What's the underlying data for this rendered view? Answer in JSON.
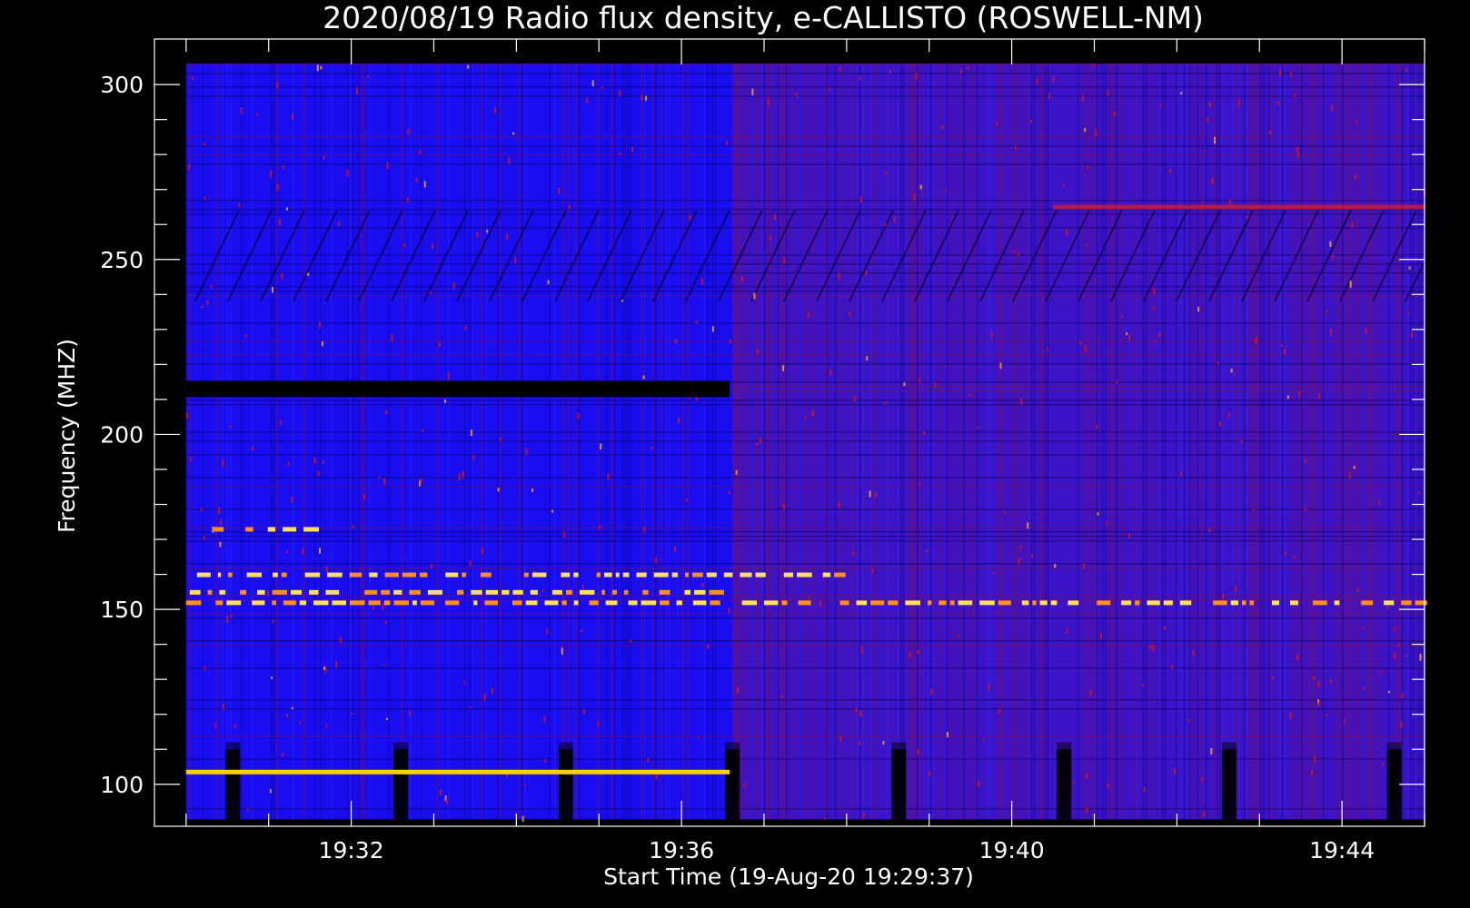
{
  "chart_data": {
    "type": "heatmap",
    "title": "2020/08/19  Radio flux density, e-CALLISTO (ROSWELL-NM)",
    "xlabel": "Start Time (19-Aug-20 19:29:37)",
    "ylabel": "Frequency (MHZ)",
    "x_ticks": [
      "19:32",
      "19:36",
      "19:40",
      "19:44"
    ],
    "y_ticks": [
      "100",
      "150",
      "200",
      "250",
      "300"
    ],
    "x_range": [
      "19:29:37",
      "19:45:00"
    ],
    "ylim": [
      313,
      88
    ],
    "data_extent": {
      "time_start": "19:30:00",
      "time_end": "19:45:00",
      "freq_min": 90,
      "freq_max": 306
    },
    "colors": {
      "background": "#000000",
      "low_flux": "#1a0df0",
      "mid_flux": "#b01020",
      "high_flux": "#ffe000",
      "gap": "#000000"
    },
    "vertical_gaps": [
      "19:30:34",
      "19:32:36",
      "19:34:36",
      "19:36:37",
      "19:38:38",
      "19:40:38",
      "19:42:38",
      "19:44:38"
    ],
    "horizontal_features": [
      {
        "freq": 103.5,
        "from": "19:30:00",
        "to": "19:36:35",
        "level": "high"
      },
      {
        "freq": 213,
        "from": "19:30:00",
        "to": "19:36:35",
        "level": "gap"
      },
      {
        "freq": 152,
        "from": "19:30:00",
        "to": "19:45:00",
        "level": "high-intermittent"
      },
      {
        "freq": 155,
        "from": "19:30:00",
        "to": "19:36:35",
        "level": "high-intermittent"
      },
      {
        "freq": 160,
        "from": "19:30:00",
        "to": "19:38:00",
        "level": "high-intermittent"
      },
      {
        "freq": 173,
        "from": "19:30:20",
        "to": "19:31:40",
        "level": "high-intermittent"
      },
      {
        "freq": 265,
        "from": "19:40:30",
        "to": "19:45:00",
        "level": "mid"
      }
    ]
  }
}
